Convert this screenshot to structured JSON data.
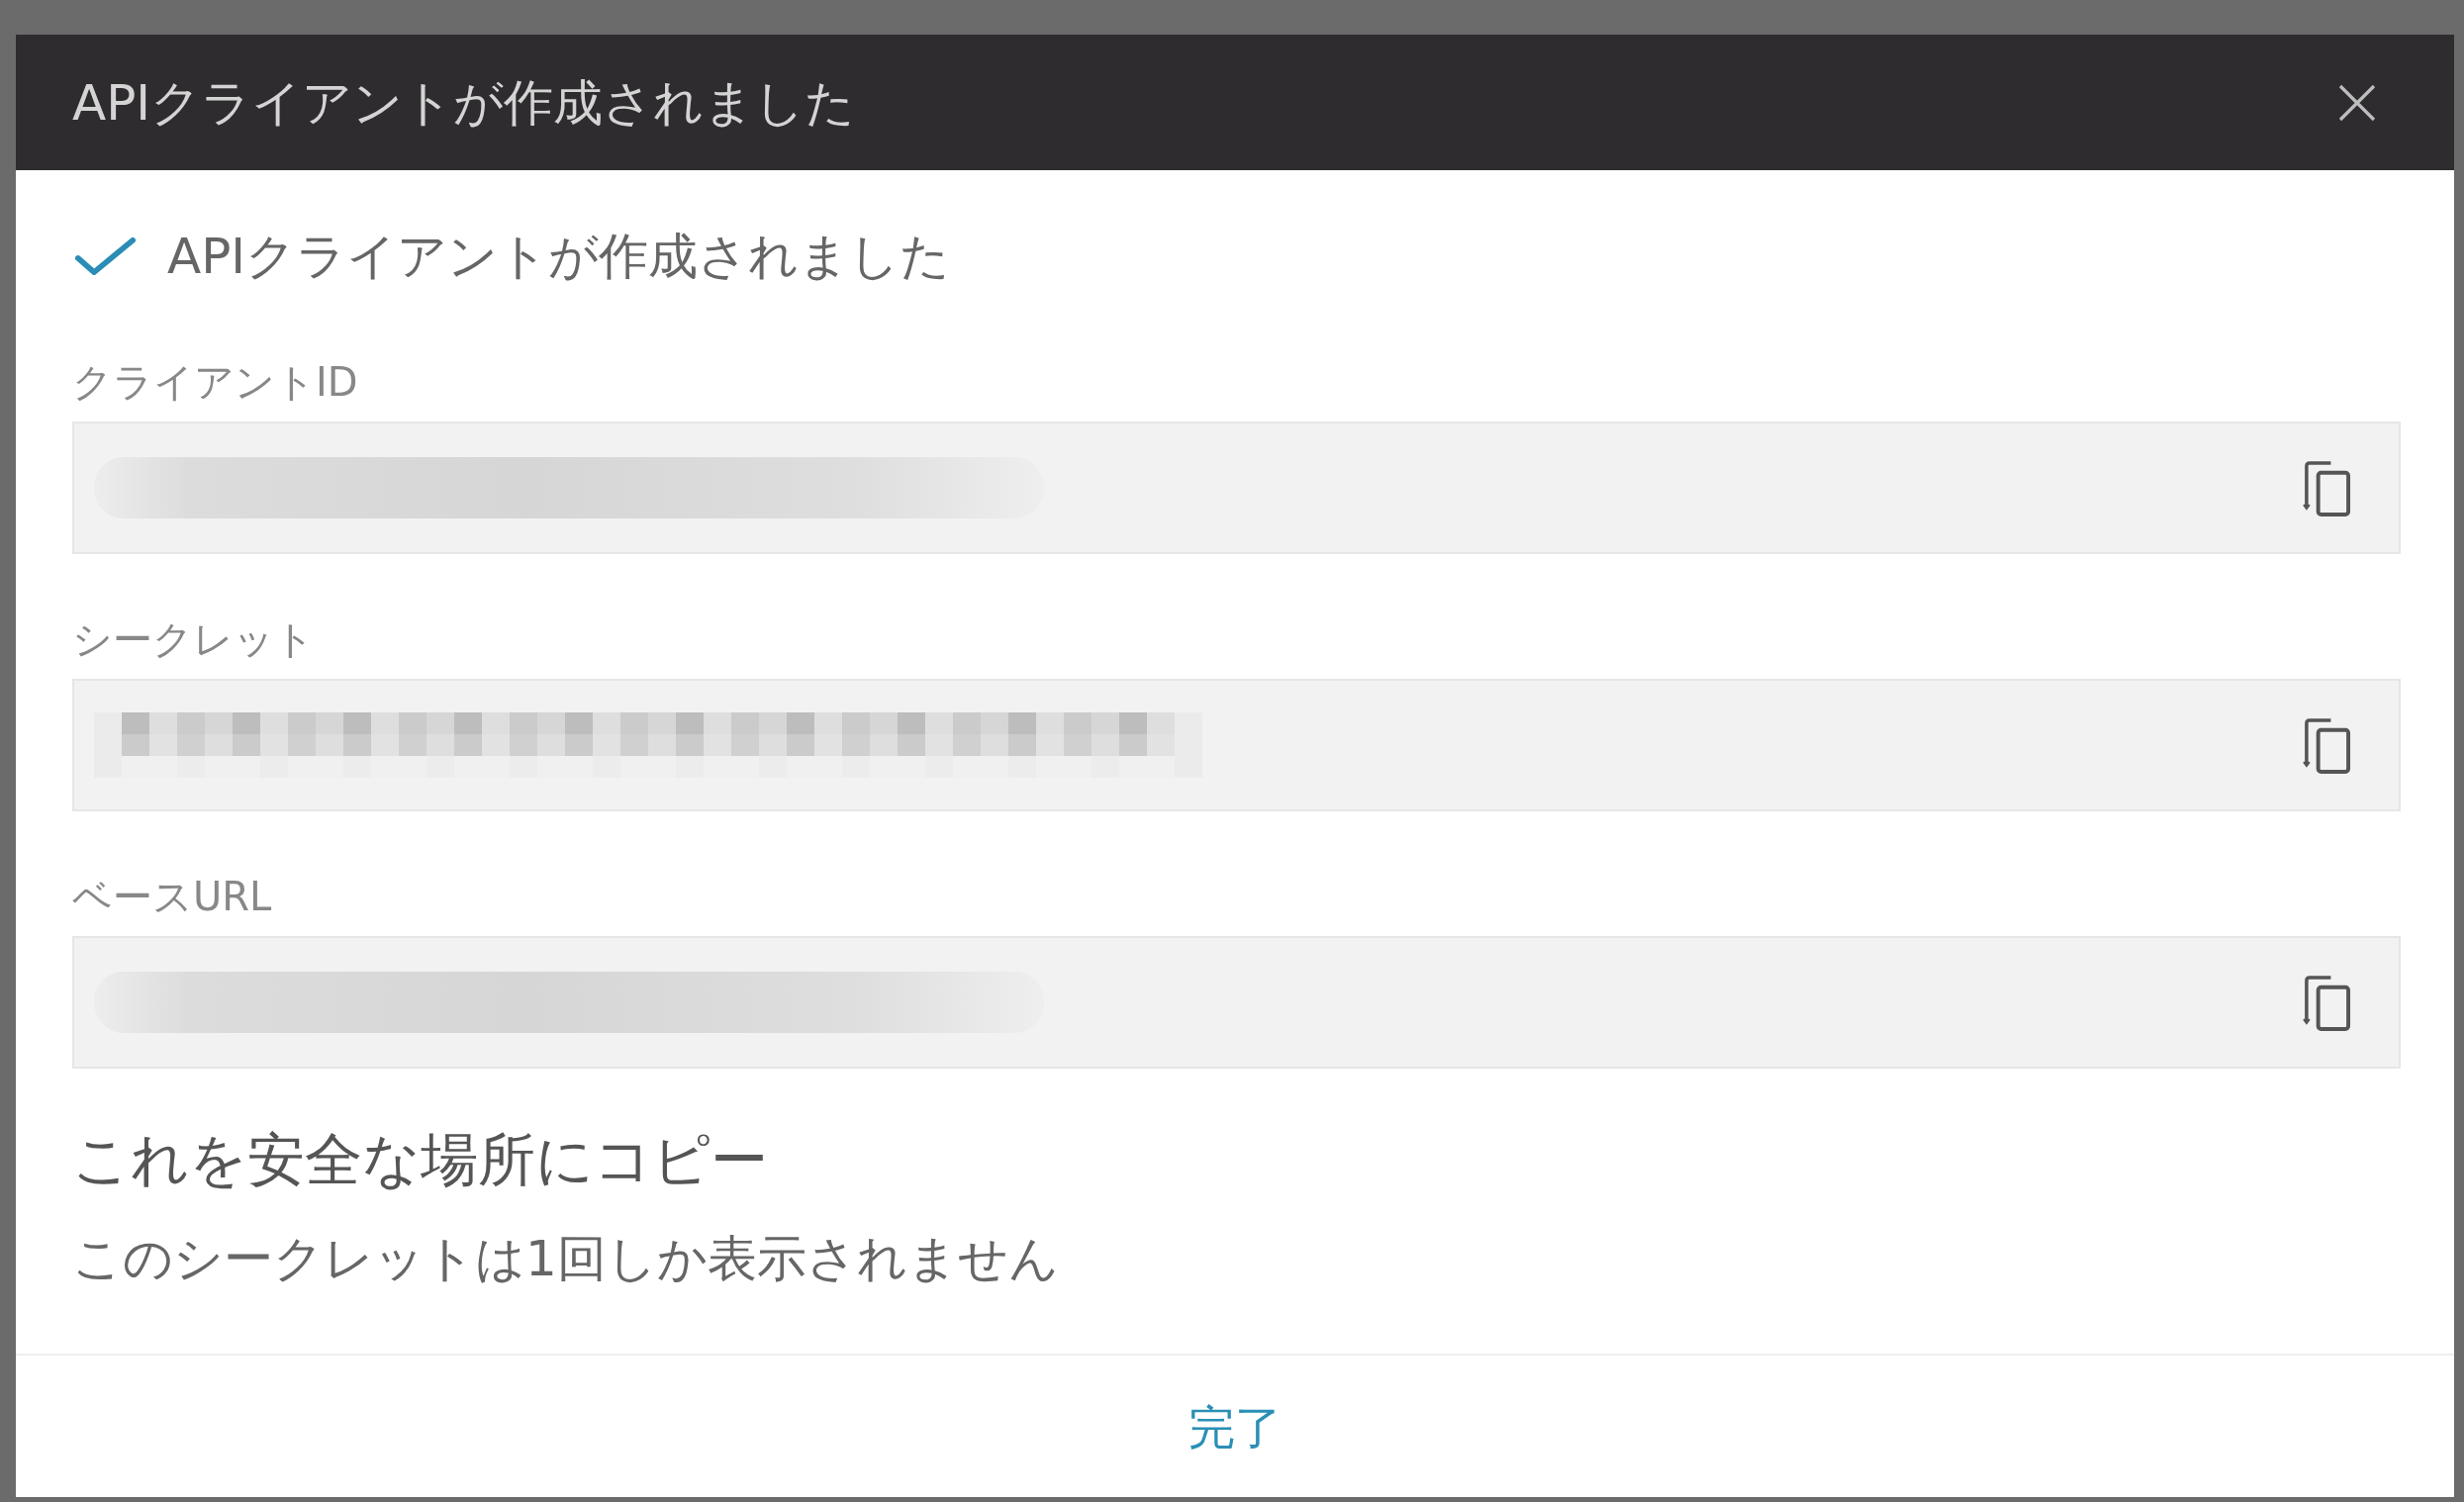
{
  "dialog": {
    "title": "APIクライアントが作成されました"
  },
  "status_message": {
    "kind": "success",
    "text": "APIクライアントが作成されました"
  },
  "fields": [
    {
      "label": "クライアントID",
      "kind": "blurred"
    },
    {
      "label": "シークレット",
      "kind": "pixelated"
    },
    {
      "label": "ベースURL",
      "kind": "blurred"
    }
  ],
  "notice": {
    "heading": "これを安全な場所にコピー",
    "text": "このシークレットは1回しか表示されません"
  },
  "footer": {
    "button": "完了"
  }
}
